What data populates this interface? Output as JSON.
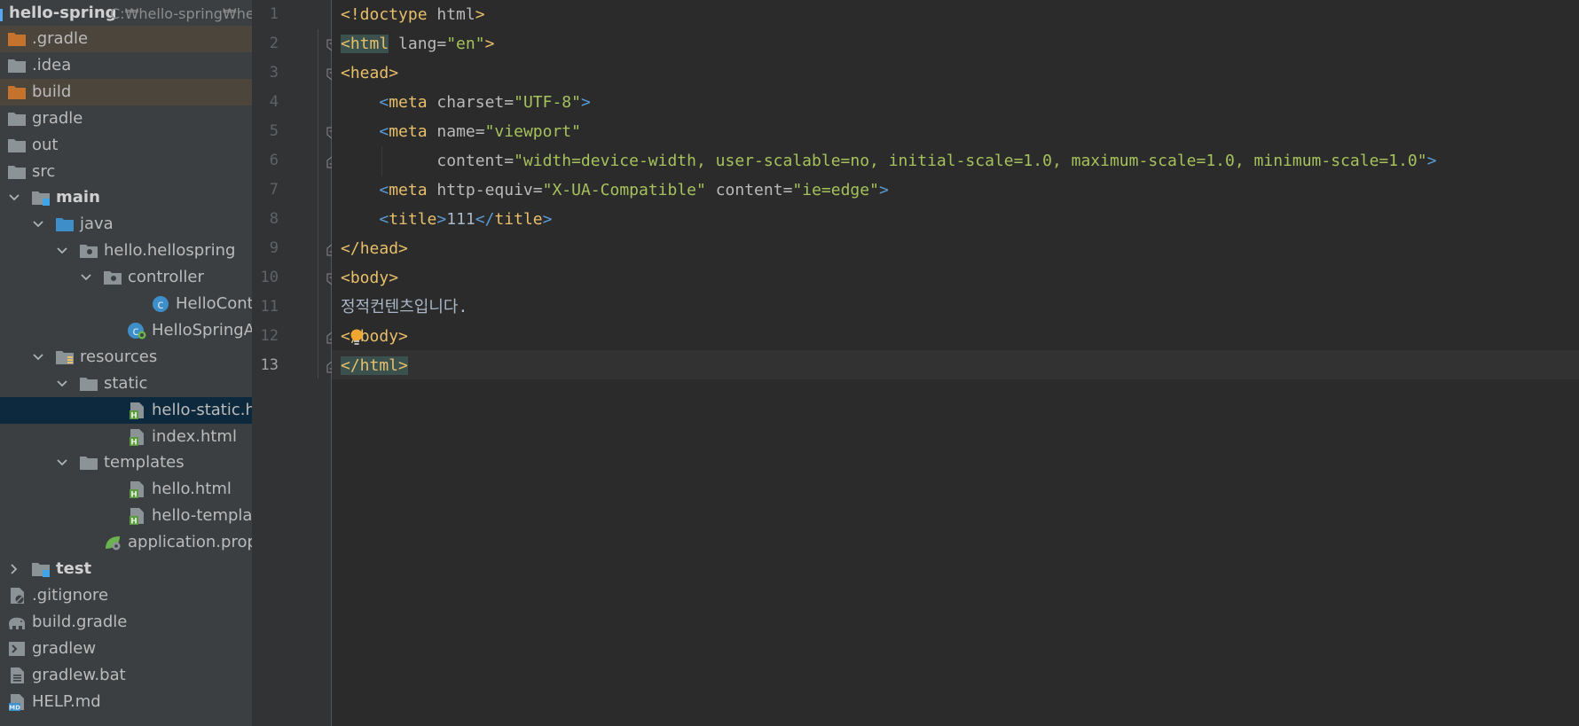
{
  "project": {
    "name": "hello-spring",
    "path": "C:₩hello-spring₩hel"
  },
  "tree": [
    {
      "label": ".gradle",
      "depth": 0,
      "icon": "folder-orange-icon",
      "highlight": "excluded"
    },
    {
      "label": ".idea",
      "depth": 0,
      "icon": "folder-icon"
    },
    {
      "label": "build",
      "depth": 0,
      "icon": "folder-orange-icon",
      "highlight": "excluded"
    },
    {
      "label": "gradle",
      "depth": 0,
      "icon": "folder-icon"
    },
    {
      "label": "out",
      "depth": 0,
      "icon": "folder-icon"
    },
    {
      "label": "src",
      "depth": 0,
      "icon": "folder-icon"
    },
    {
      "label": "main",
      "depth": 0,
      "icon": "module-folder-icon",
      "expanded": true,
      "bold": true
    },
    {
      "label": "java",
      "depth": 1,
      "icon": "folder-blue-icon",
      "expanded": true
    },
    {
      "label": "hello.hellospring",
      "depth": 2,
      "icon": "package-icon",
      "expanded": true
    },
    {
      "label": "controller",
      "depth": 3,
      "icon": "package-icon",
      "expanded": true
    },
    {
      "label": "HelloController",
      "depth": 5,
      "icon": "java-class-icon"
    },
    {
      "label": "HelloSpringApplication",
      "depth": 4,
      "icon": "spring-boot-class-icon"
    },
    {
      "label": "resources",
      "depth": 1,
      "icon": "resources-folder-icon",
      "expanded": true
    },
    {
      "label": "static",
      "depth": 2,
      "icon": "folder-icon",
      "expanded": true
    },
    {
      "label": "hello-static.html",
      "depth": 4,
      "icon": "html-file-icon",
      "highlight": "selected"
    },
    {
      "label": "index.html",
      "depth": 4,
      "icon": "html-file-icon"
    },
    {
      "label": "templates",
      "depth": 2,
      "icon": "folder-icon",
      "expanded": true
    },
    {
      "label": "hello.html",
      "depth": 4,
      "icon": "html-file-icon"
    },
    {
      "label": "hello-template.html",
      "depth": 4,
      "icon": "html-file-icon"
    },
    {
      "label": "application.properties",
      "depth": 3,
      "icon": "spring-properties-icon"
    },
    {
      "label": "test",
      "depth": 0,
      "icon": "module-folder-icon",
      "collapsed": true,
      "bold": true
    },
    {
      "label": ".gitignore",
      "depth": 0,
      "icon": "gitignore-file-icon"
    },
    {
      "label": "build.gradle",
      "depth": 0,
      "icon": "gradle-elephant-icon"
    },
    {
      "label": "gradlew",
      "depth": 0,
      "icon": "shell-script-icon"
    },
    {
      "label": "gradlew.bat",
      "depth": 0,
      "icon": "text-file-icon"
    },
    {
      "label": "HELP.md",
      "depth": 0,
      "icon": "markdown-file-icon"
    }
  ],
  "editor": {
    "line_numbers": [
      "1",
      "2",
      "3",
      "4",
      "5",
      "6",
      "7",
      "8",
      "9",
      "10",
      "11",
      "12",
      "13"
    ],
    "current_line": "13",
    "lines": [
      [
        {
          "t": "doctype",
          "v": "<!doctype "
        },
        {
          "t": "att",
          "v": "html"
        },
        {
          "t": "doctype",
          "v": ">"
        }
      ],
      [
        {
          "t": "tagm",
          "v": "<html"
        },
        {
          "t": "att",
          "v": " lang"
        },
        {
          "t": "eq",
          "v": "="
        },
        {
          "t": "str",
          "v": "\"en\""
        },
        {
          "t": "br",
          "v": ">"
        }
      ],
      [
        {
          "t": "br",
          "v": "<"
        },
        {
          "t": "tag",
          "v": "head"
        },
        {
          "t": "br",
          "v": ">"
        }
      ],
      [
        {
          "t": "txt",
          "v": "    "
        },
        {
          "t": "brb",
          "v": "<"
        },
        {
          "t": "tag",
          "v": "meta"
        },
        {
          "t": "att",
          "v": " charset"
        },
        {
          "t": "eq",
          "v": "="
        },
        {
          "t": "str",
          "v": "\"UTF-8\""
        },
        {
          "t": "brb",
          "v": ">"
        }
      ],
      [
        {
          "t": "txt",
          "v": "    "
        },
        {
          "t": "brb",
          "v": "<"
        },
        {
          "t": "tag",
          "v": "meta"
        },
        {
          "t": "att",
          "v": " name"
        },
        {
          "t": "eq",
          "v": "="
        },
        {
          "t": "str",
          "v": "\"viewport\""
        }
      ],
      [
        {
          "t": "txt",
          "v": "          "
        },
        {
          "t": "att",
          "v": "content"
        },
        {
          "t": "eq",
          "v": "="
        },
        {
          "t": "str",
          "v": "\"width=device-width, user-scalable=no, initial-scale=1.0, maximum-scale=1.0, minimum-scale=1.0\""
        },
        {
          "t": "brb",
          "v": ">"
        }
      ],
      [
        {
          "t": "txt",
          "v": "    "
        },
        {
          "t": "brb",
          "v": "<"
        },
        {
          "t": "tag",
          "v": "meta"
        },
        {
          "t": "att",
          "v": " http-equiv"
        },
        {
          "t": "eq",
          "v": "="
        },
        {
          "t": "str",
          "v": "\"X-UA-Compatible\""
        },
        {
          "t": "att",
          "v": " content"
        },
        {
          "t": "eq",
          "v": "="
        },
        {
          "t": "str",
          "v": "\"ie=edge\""
        },
        {
          "t": "brb",
          "v": ">"
        }
      ],
      [
        {
          "t": "txt",
          "v": "    "
        },
        {
          "t": "brb",
          "v": "<"
        },
        {
          "t": "tag",
          "v": "title"
        },
        {
          "t": "brb",
          "v": ">"
        },
        {
          "t": "txt",
          "v": "111"
        },
        {
          "t": "brb",
          "v": "</"
        },
        {
          "t": "tag",
          "v": "title"
        },
        {
          "t": "brb",
          "v": ">"
        }
      ],
      [
        {
          "t": "br",
          "v": "</"
        },
        {
          "t": "tag",
          "v": "head"
        },
        {
          "t": "br",
          "v": ">"
        }
      ],
      [
        {
          "t": "br",
          "v": "<"
        },
        {
          "t": "tag",
          "v": "body"
        },
        {
          "t": "br",
          "v": ">"
        }
      ],
      [
        {
          "t": "txt",
          "v": "정적컨텐츠입니다."
        }
      ],
      [
        {
          "t": "br",
          "v": "</"
        },
        {
          "t": "tag",
          "v": "body"
        },
        {
          "t": "br",
          "v": ">"
        }
      ],
      [
        {
          "t": "tagm",
          "v": "</html>"
        }
      ]
    ]
  },
  "colors": {
    "sidebar_bg": "#3c3f41",
    "editor_bg": "#2b2b2b",
    "gutter_bg": "#313335",
    "selected_row": "#0d293e",
    "excluded_row": "#4b453c",
    "tag": "#e8bf6a",
    "string": "#a5c25c",
    "attribute": "#bababa"
  }
}
